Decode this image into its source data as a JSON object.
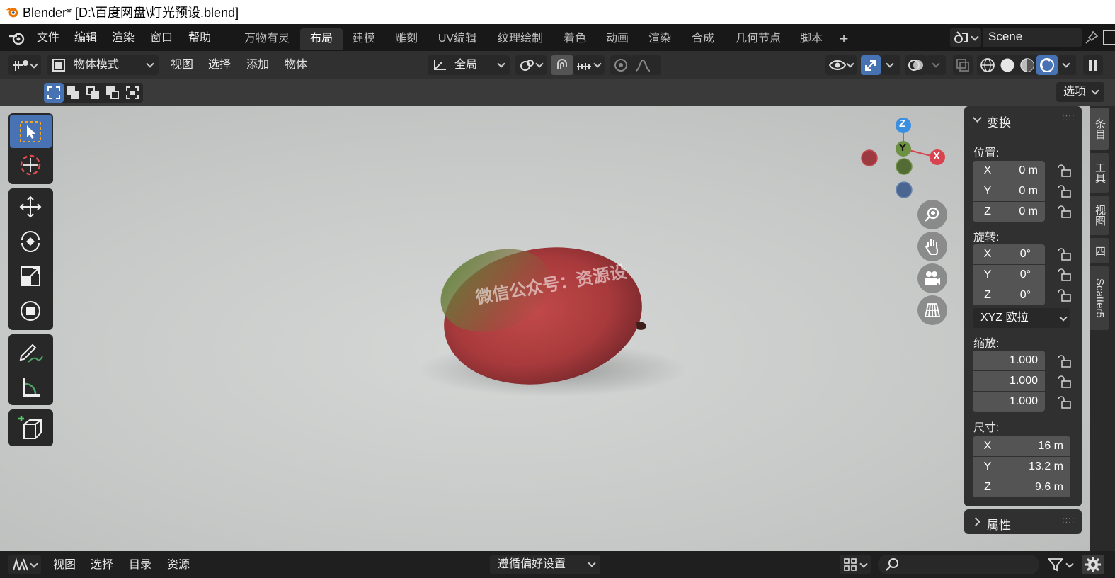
{
  "window": {
    "title": "Blender* [D:\\百度网盘\\灯光预设.blend]"
  },
  "topbar": {
    "menus": [
      "文件",
      "编辑",
      "渲染",
      "窗口",
      "帮助"
    ],
    "workspaces": [
      "万物有灵",
      "布局",
      "建模",
      "雕刻",
      "UV编辑",
      "纹理绘制",
      "着色",
      "动画",
      "渲染",
      "合成",
      "几何节点",
      "脚本"
    ],
    "active_workspace": "布局",
    "add_tab": "+",
    "scene": "Scene"
  },
  "header": {
    "mode": "物体模式",
    "menus": [
      "视图",
      "选择",
      "添加",
      "物体"
    ],
    "orientation": "全局"
  },
  "subheader": {
    "options": "选项"
  },
  "viewport": {
    "watermark": "微信公众号：资源设",
    "gizmo": {
      "z": "Z",
      "y": "Y",
      "x": "X"
    }
  },
  "right_tabs": [
    "条目",
    "工具",
    "视图",
    "四",
    "Scatter5"
  ],
  "npanel": {
    "transform_title": "变换",
    "location_label": "位置:",
    "location": [
      {
        "axis": "X",
        "value": "0 m"
      },
      {
        "axis": "Y",
        "value": "0 m"
      },
      {
        "axis": "Z",
        "value": "0 m"
      }
    ],
    "rotation_label": "旋转:",
    "rotation": [
      {
        "axis": "X",
        "value": "0°"
      },
      {
        "axis": "Y",
        "value": "0°"
      },
      {
        "axis": "Z",
        "value": "0°"
      }
    ],
    "rotation_mode": "XYZ 欧拉",
    "scale_label": "缩放:",
    "scale": [
      "1.000",
      "1.000",
      "1.000"
    ],
    "dimensions_label": "尺寸:",
    "dimensions": [
      {
        "axis": "X",
        "value": "16 m"
      },
      {
        "axis": "Y",
        "value": "13.2 m"
      },
      {
        "axis": "Z",
        "value": "9.6 m"
      }
    ],
    "properties_title": "属性"
  },
  "bottombar": {
    "menus": [
      "视图",
      "选择",
      "目录",
      "资源"
    ],
    "import": "遵循偏好设置"
  },
  "colors": {
    "accent": "#4772b3",
    "axis_x": "#d9424f",
    "axis_y": "#6d9143",
    "axis_z": "#3b8fe0"
  }
}
